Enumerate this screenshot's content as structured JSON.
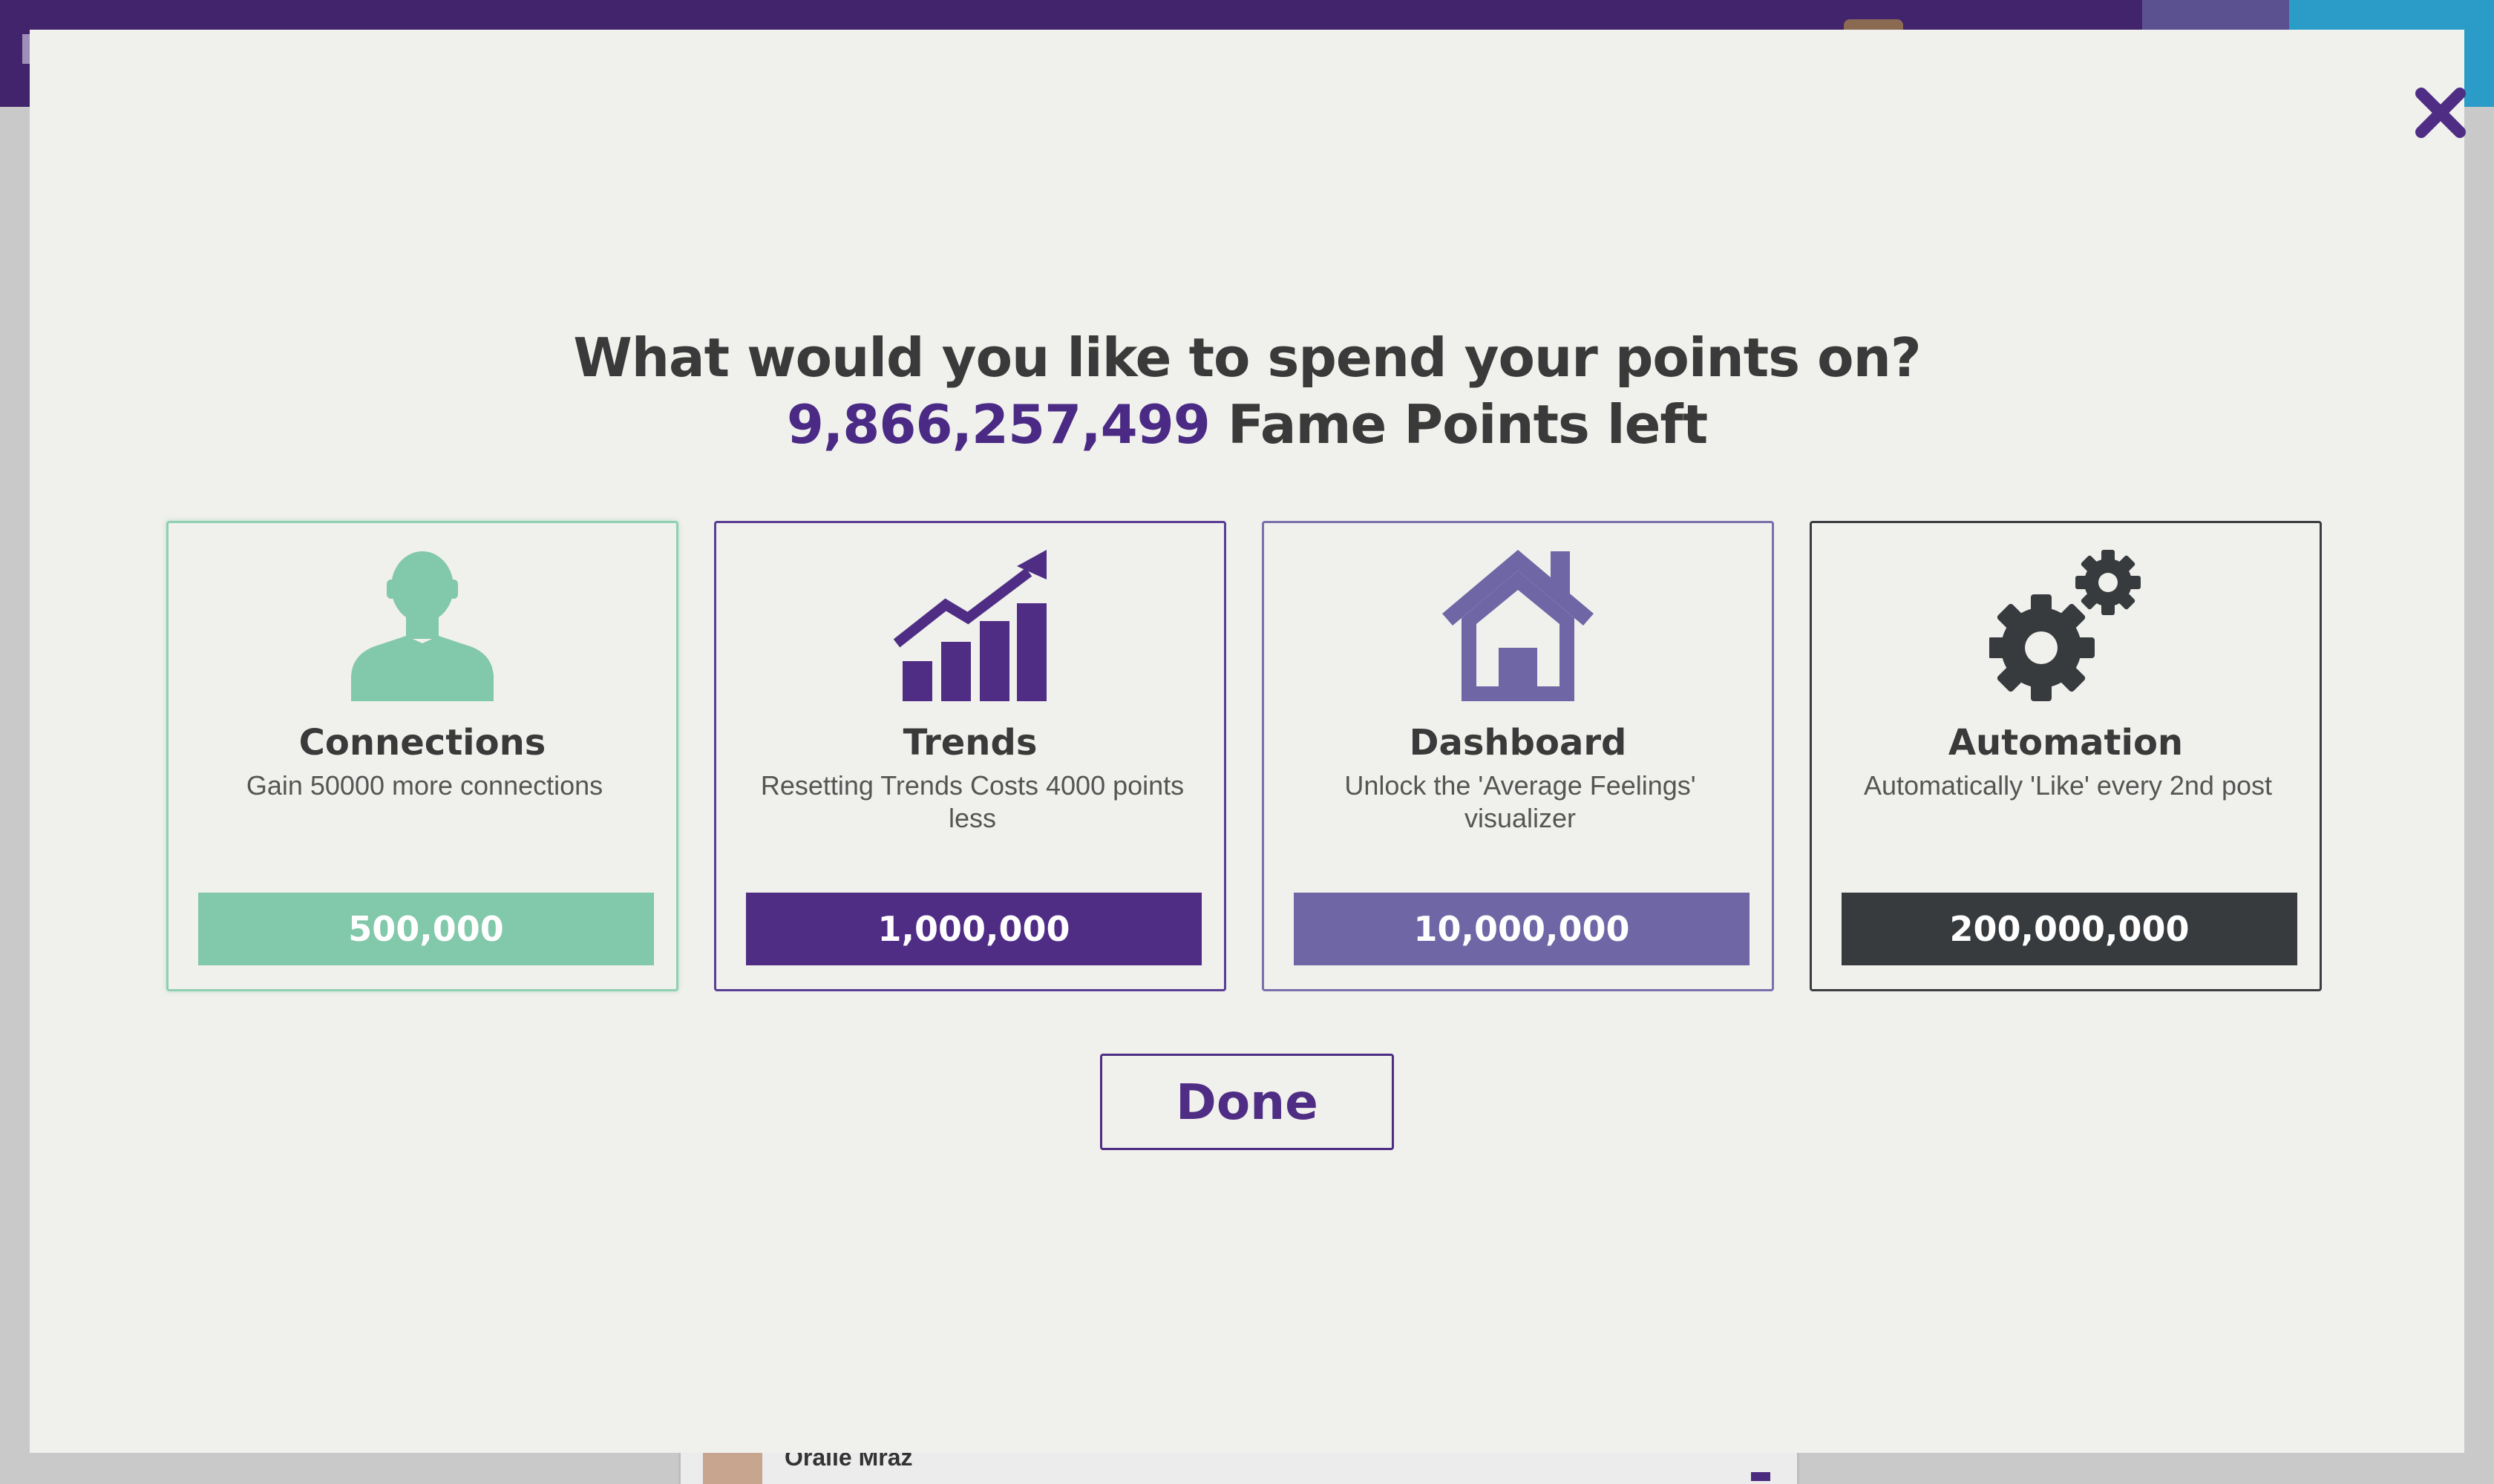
{
  "background": {
    "feed_user_name": "Oralie Mraz"
  },
  "modal": {
    "headline": "What would you like to spend your points on?",
    "points_value": "9,866,257,499",
    "points_suffix": " Fame Points left",
    "done_label": "Done",
    "close_icon": "close-icon",
    "cards": [
      {
        "title": "Connections",
        "description": "Gain 50000 more connections",
        "price": "500,000",
        "icon": "person-icon",
        "color": "#82c8aa"
      },
      {
        "title": "Trends",
        "description": "Resetting Trends Costs 4000 points less",
        "price": "1,000,000",
        "icon": "trend-chart-icon",
        "color": "#4f2d85"
      },
      {
        "title": "Dashboard",
        "description": "Unlock the 'Average Feelings' visualizer",
        "price": "10,000,000",
        "icon": "house-icon",
        "color": "#6f67a5"
      },
      {
        "title": "Automation",
        "description": "Automatically 'Like' every 2nd post",
        "price": "200,000,000",
        "icon": "gears-icon",
        "color": "#373b3d"
      }
    ]
  },
  "colors": {
    "accent_purple": "#4f2d85",
    "topbar": "#41246b",
    "modal_bg": "#f0f0ec",
    "text_dark": "#3a3a3a"
  }
}
